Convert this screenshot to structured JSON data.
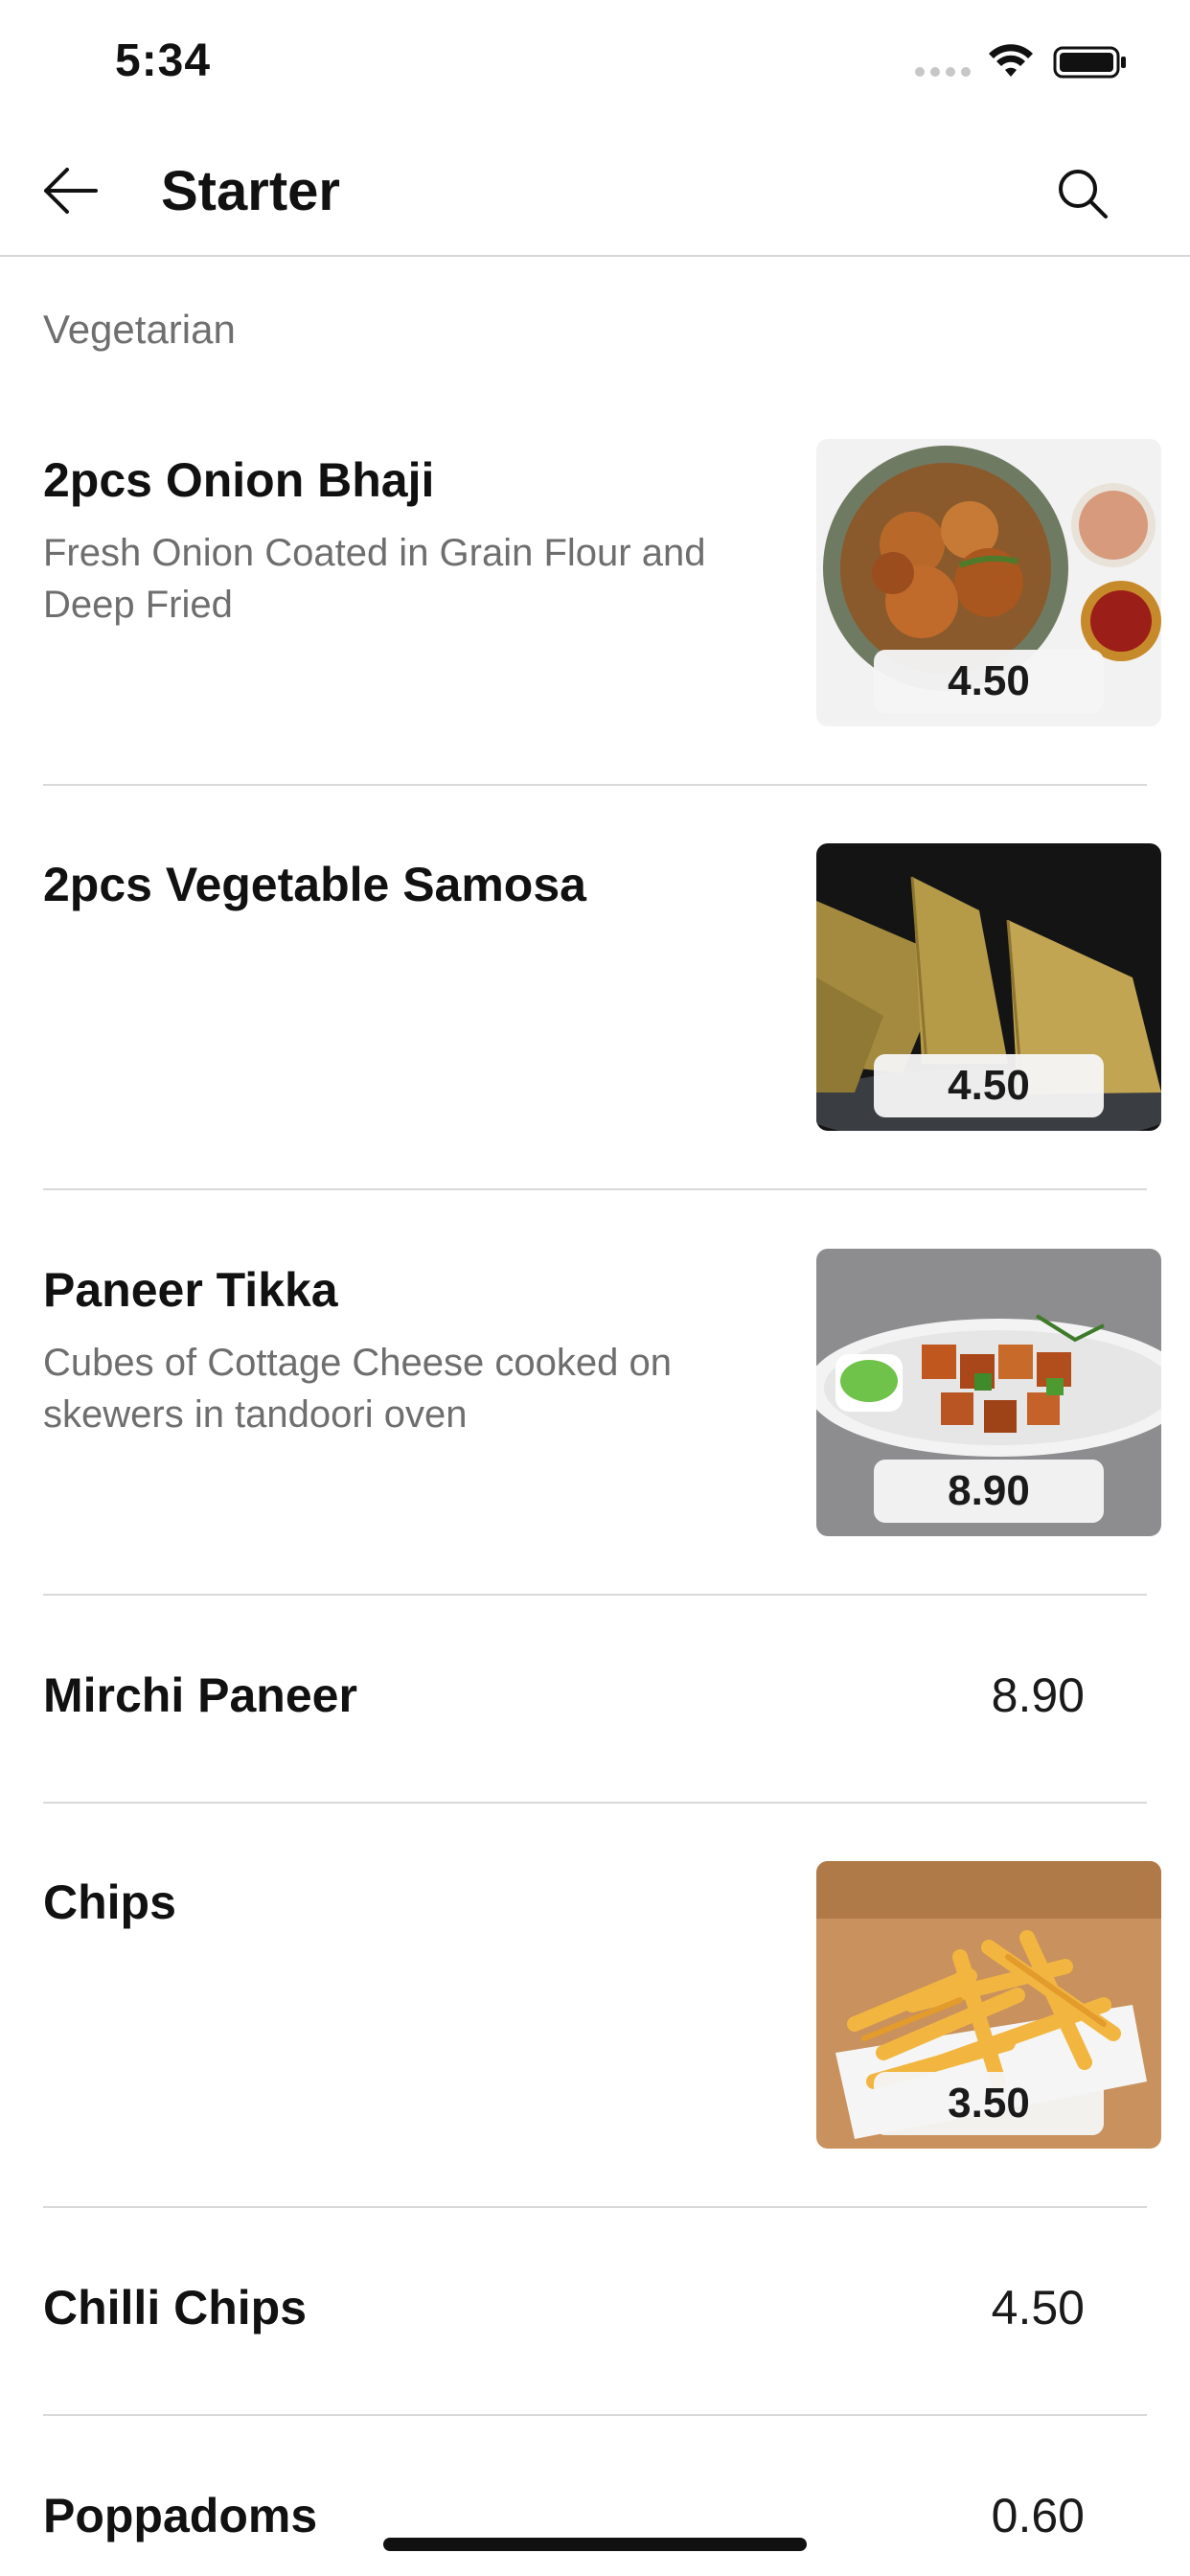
{
  "status_bar": {
    "time": "5:34"
  },
  "nav": {
    "title": "Starter",
    "back_icon": "arrow-left-icon",
    "search_icon": "search-icon"
  },
  "section": {
    "title": "Vegetarian"
  },
  "items": [
    {
      "name": "2pcs Onion Bhaji",
      "description": "Fresh Onion Coated in Grain Flour and Deep Fried",
      "price": "4.50",
      "image": "onion-bhaji-photo"
    },
    {
      "name": "2pcs Vegetable Samosa",
      "description": "",
      "price": "4.50",
      "image": "vegetable-samosa-photo"
    },
    {
      "name": "Paneer Tikka",
      "description": "Cubes of Cottage Cheese cooked on skewers in tandoori oven",
      "price": "8.90",
      "image": "paneer-tikka-photo"
    },
    {
      "name": "Mirchi Paneer",
      "description": "",
      "price": "8.90"
    },
    {
      "name": "Chips",
      "description": "",
      "price": "3.50",
      "image": "chips-photo"
    },
    {
      "name": "Chilli Chips",
      "description": "",
      "price": "4.50"
    },
    {
      "name": "Poppadoms",
      "description": "",
      "price": "0.60"
    }
  ],
  "colors": {
    "text_primary": "#111111",
    "text_secondary": "#6e6e6e",
    "divider": "#d9d9d9"
  }
}
